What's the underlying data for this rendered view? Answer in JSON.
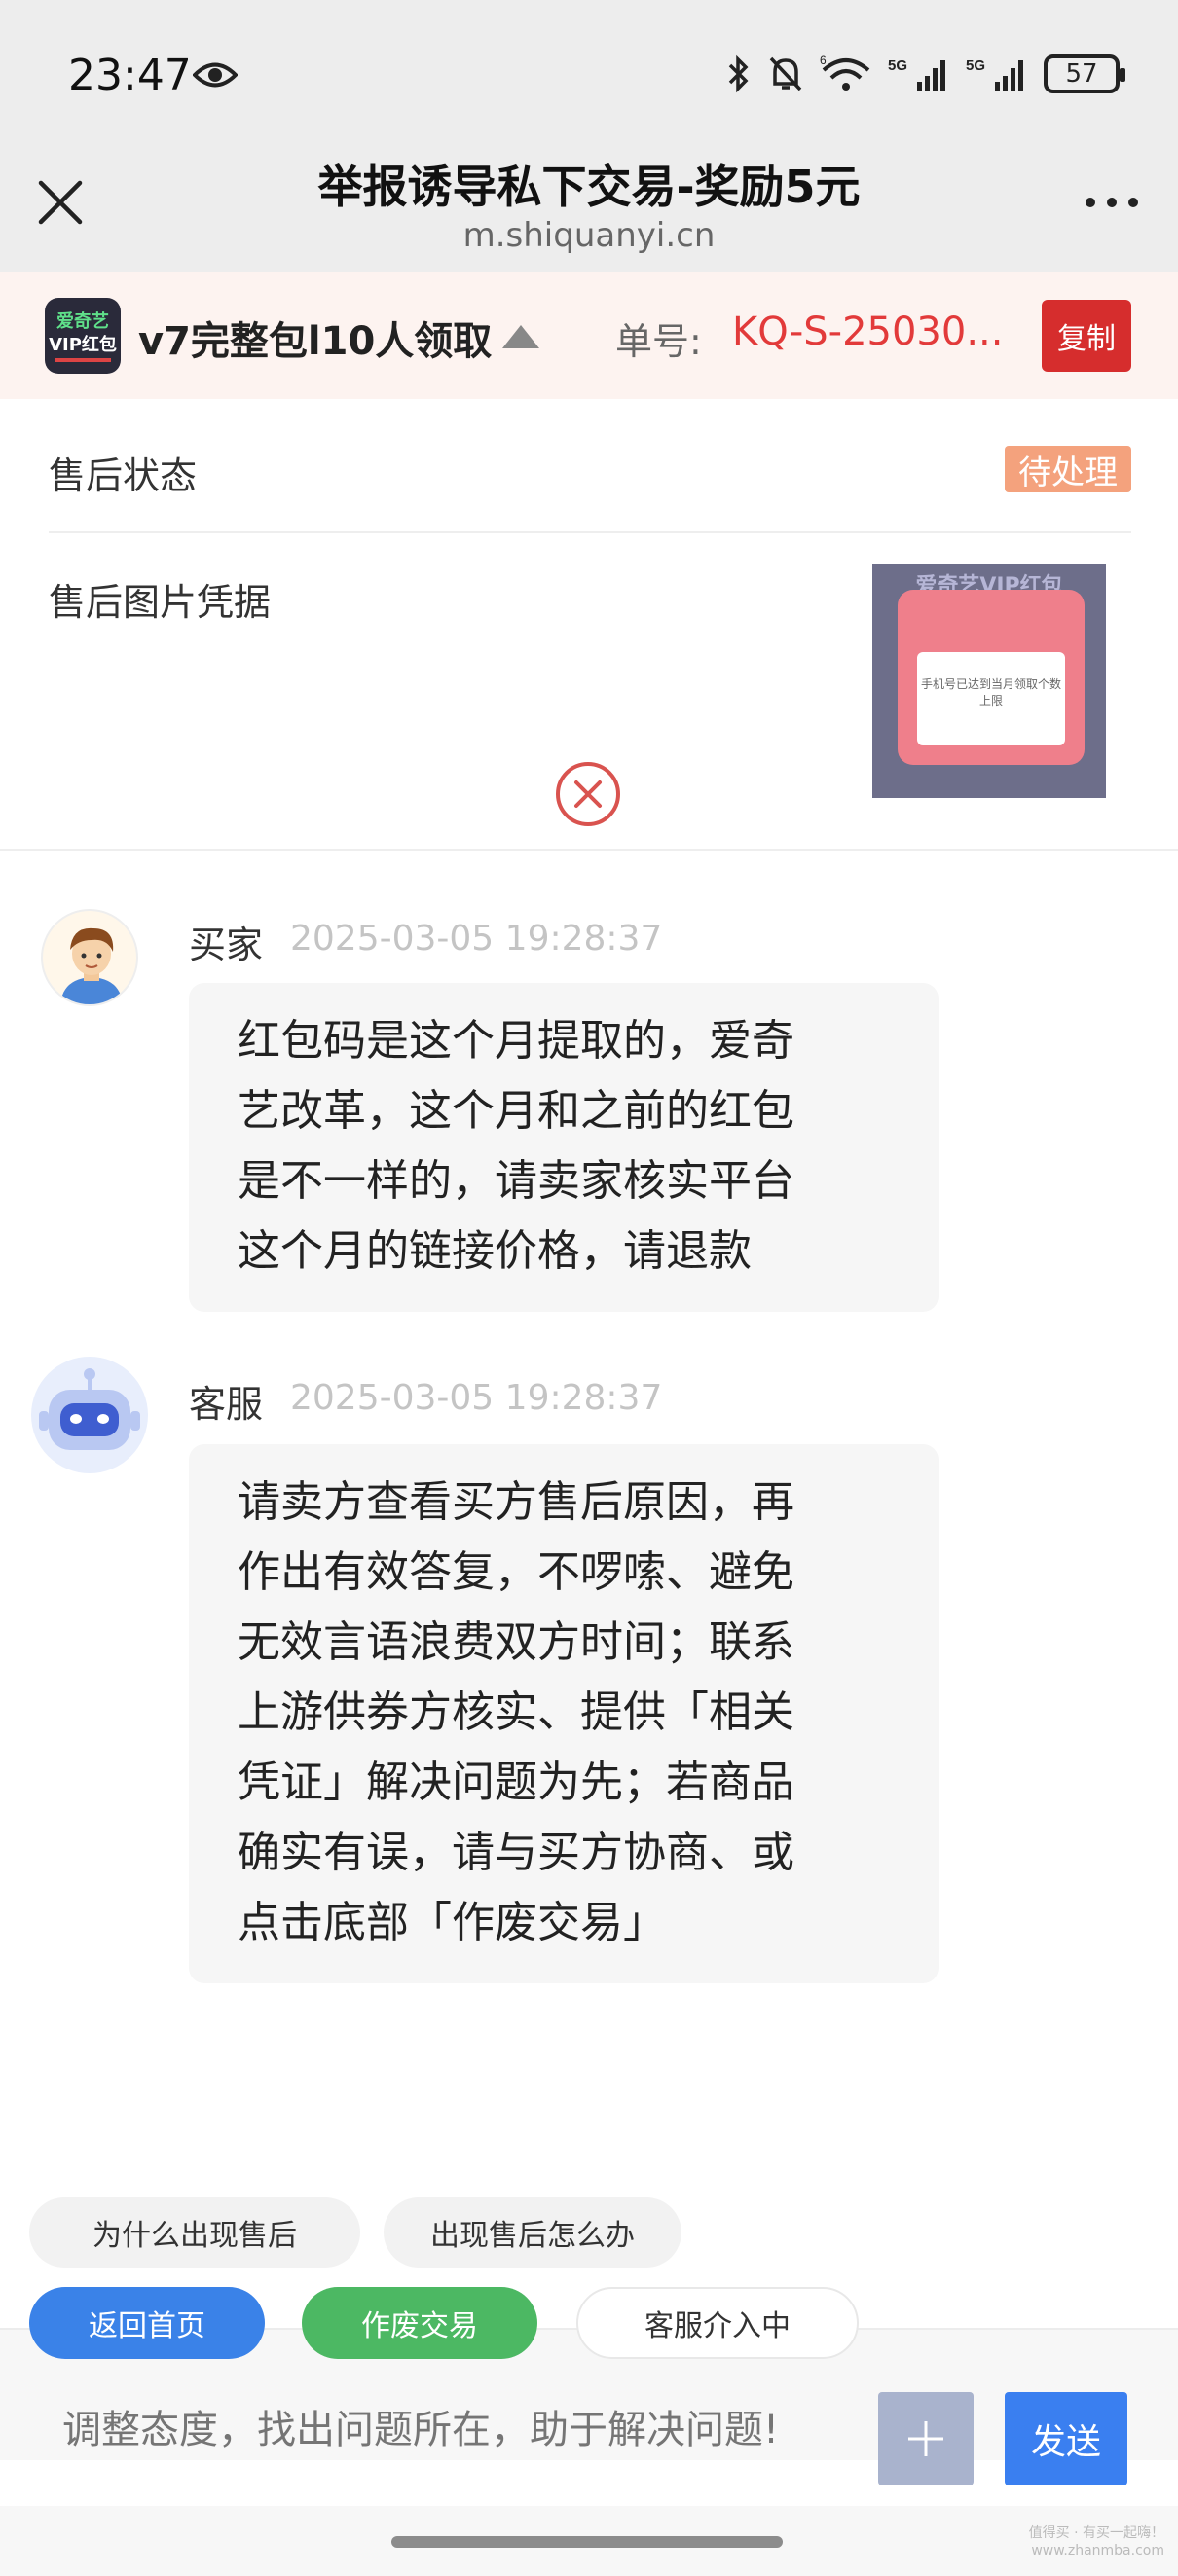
{
  "status_bar": {
    "time": "23:47",
    "battery": "57"
  },
  "header": {
    "title": "举报诱导私下交易-奖励5元",
    "url": "m.shiquanyi.cn"
  },
  "product": {
    "logo_line1": "爱奇艺",
    "logo_line2": "VIP红包",
    "name": "v7完整包l10人领取",
    "order_label": "单号:",
    "order_no": "KQ-S-25030...",
    "copy_label": "复制"
  },
  "aftersale": {
    "status_label": "售后状态",
    "status_value": "待处理",
    "evidence_label": "售后图片凭据",
    "evidence_thumb_top": "爱奇艺VIP红包",
    "evidence_thumb_text": "手机号已达到当月领取个数上限"
  },
  "messages": [
    {
      "sender": "买家",
      "time": "2025-03-05 19:28:37",
      "lines": [
        "红包码是这个月提取的，爱奇",
        "艺改革，这个月和之前的红包",
        "是不一样的，请卖家核实平台",
        "这个月的链接价格，请退款"
      ]
    },
    {
      "sender": "客服",
      "time": "2025-03-05 19:28:37",
      "lines": [
        "请卖方查看买方售后原因，再",
        "作出有效答复，不啰嗦、避免",
        "无效言语浪费双方时间；联系",
        "上游供券方核实、提供「相关",
        "凭证」解决问题为先；若商品",
        "确实有误，请与买方协商、或",
        "点击底部「作废交易」"
      ]
    }
  ],
  "quick_chips": [
    "为什么出现售后",
    "出现售后怎么办"
  ],
  "actions": {
    "home": "返回首页",
    "cancel_trade": "作废交易",
    "service": "客服介入中"
  },
  "input": {
    "placeholder": "调整态度，找出问题所在，助于解决问题!",
    "send": "发送"
  },
  "watermark": [
    "值得买 · 有买一起嗨！",
    "www.zhanmba.com"
  ],
  "colors": {
    "accent_red": "#e23a3a",
    "badge_orange": "#f4a27d",
    "primary_blue": "#3a82e8",
    "green": "#4cb863"
  }
}
